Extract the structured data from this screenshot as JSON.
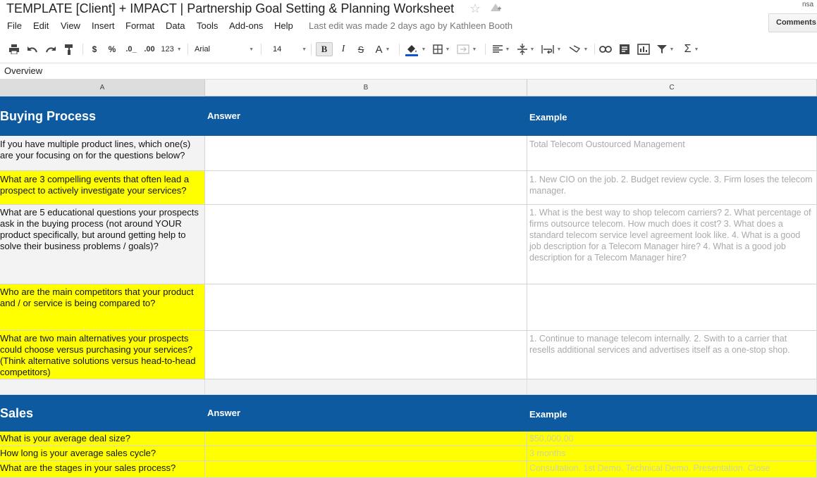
{
  "header": {
    "doc_title": "TEMPLATE [Client] + IMPACT | Partnership Goal Setting & Planning Worksheet",
    "user": "nsa",
    "comments_label": "Comments",
    "last_edit": "Last edit was made 2 days ago by Kathleen Booth"
  },
  "menu": [
    "File",
    "Edit",
    "View",
    "Insert",
    "Format",
    "Data",
    "Tools",
    "Add-ons",
    "Help"
  ],
  "toolbar": {
    "currency": "$",
    "percent": "%",
    "dec_decrease": ".0_",
    "dec_increase": ".00",
    "format_123": "123",
    "font": "Arial",
    "font_size": "14",
    "bold": "B",
    "italic": "I",
    "strike": "S",
    "text_color": "A",
    "sigma": "Σ",
    "fill_color": "#1155cc"
  },
  "formula_bar": {
    "value": "Overview"
  },
  "columns": [
    "A",
    "B",
    "C"
  ],
  "sections": [
    {
      "title": "Buying Process",
      "answer_header": "Answer",
      "example_header": "Example",
      "rows": [
        {
          "question": "If you have multiple product lines, which one(s) are your focusing on for the questions below?",
          "example": "Total Telecom Oustourced Management"
        },
        {
          "question": "What are 3 compelling events that often lead a prospect to actively investigate your services?",
          "example": "1. New CIO on the job. 2. Budget review cycle. 3. Firm loses the telecom manager."
        },
        {
          "question": "What are 5 educational questions your prospects ask in the buying process (not around YOUR product specifically, but around getting help to solve their business problems / goals)?",
          "example": "1. What is the best way to shop telecom carriers? 2. What percentage of firms outsource telecom. How much does it cost? 3. What does a standard telecom service level agreement look like. 4. What is a good job description for a Telecom Manager hire? 4. What is a good job description for a Telecom Manager hire?"
        },
        {
          "question": "Who are the main competitors that your product and / or service is being compared to?",
          "example": ""
        },
        {
          "question": "What are two main alternatives your prospects could choose versus purchasing your services? (Think alternative solutions versus head-to-head competitors)",
          "example": "1. Continue to manage telecom internally. 2. Swith to a carrier that resells additional services and advertises itself as a one-stop shop."
        }
      ]
    },
    {
      "title": "Sales",
      "answer_header": "Answer",
      "example_header": "Example",
      "rows": [
        {
          "question": "What is your average deal size?",
          "example": "$50,000.00"
        },
        {
          "question": "How long is your average sales cycle?",
          "example": "3 months"
        },
        {
          "question": "What are the stages in your sales process?",
          "example": "Consultation. 1st Demo. Technical Demo. Presentation. Close"
        }
      ]
    }
  ],
  "colors": {
    "header_blue": "#0d5aa1",
    "highlight_yellow": "#ffff00",
    "example_grey": "#a9a9a9"
  }
}
